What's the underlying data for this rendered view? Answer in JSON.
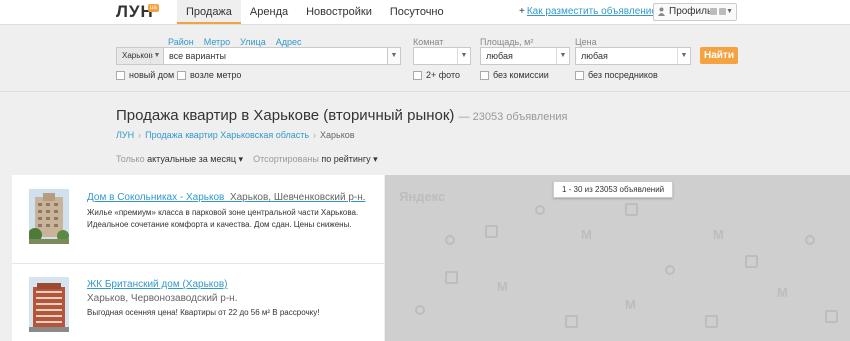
{
  "header": {
    "logo": "ЛУН",
    "logo_badge": "ua",
    "nav": [
      "Продажа",
      "Аренда",
      "Новостройки",
      "Посуточно"
    ],
    "howto_plus": "+",
    "howto": "Как разместить объявление?",
    "profile": "Профиль"
  },
  "filters": {
    "links": [
      "Район",
      "Метро",
      "Улица",
      "Адрес"
    ],
    "city": "Харьков",
    "search_value": "все варианты",
    "rooms_label": "Комнат",
    "area_label": "Площадь, м²",
    "area_value": "любая",
    "price_label": "Цена",
    "price_value": "любая",
    "find_button": "Найти",
    "checkboxes": [
      "новый дом",
      "возле метро",
      "2+ фото",
      "без комиссии",
      "без посредников"
    ]
  },
  "page": {
    "title": "Продажа квартир в Харькове (вторичный рынок)",
    "count": "— 23053 объявления",
    "breadcrumbs": [
      "ЛУН",
      "Продажа квартир Харьковская область",
      "Харьков"
    ],
    "filter_prefix": "Только",
    "filter_value": "актуальные за месяц",
    "sort_prefix": "Отсортированы",
    "sort_value": "по рейтингу"
  },
  "listings": [
    {
      "name": "Дом в Сокольниках - Харьков",
      "location": "Харьков, Шевченковский р-н.",
      "description": "Жилье «премиум» класса в парковой зоне центральной части Харькова. Идеальное сочетание комфорта и качества. Дом сдан. Цены снижены."
    },
    {
      "name": "ЖК Британский дом (Харьков)",
      "location": "Харьков, Червонозаводский р-н.",
      "description": "Выгодная осенняя цена! Квартиры от 22 до 56 м² В рассрочку!"
    }
  ],
  "map": {
    "watermark": "Яндекс",
    "results": "1 - 30 из 23053 объявлений"
  },
  "colors": {
    "accent": "#f4a340",
    "link": "#3399cc"
  }
}
